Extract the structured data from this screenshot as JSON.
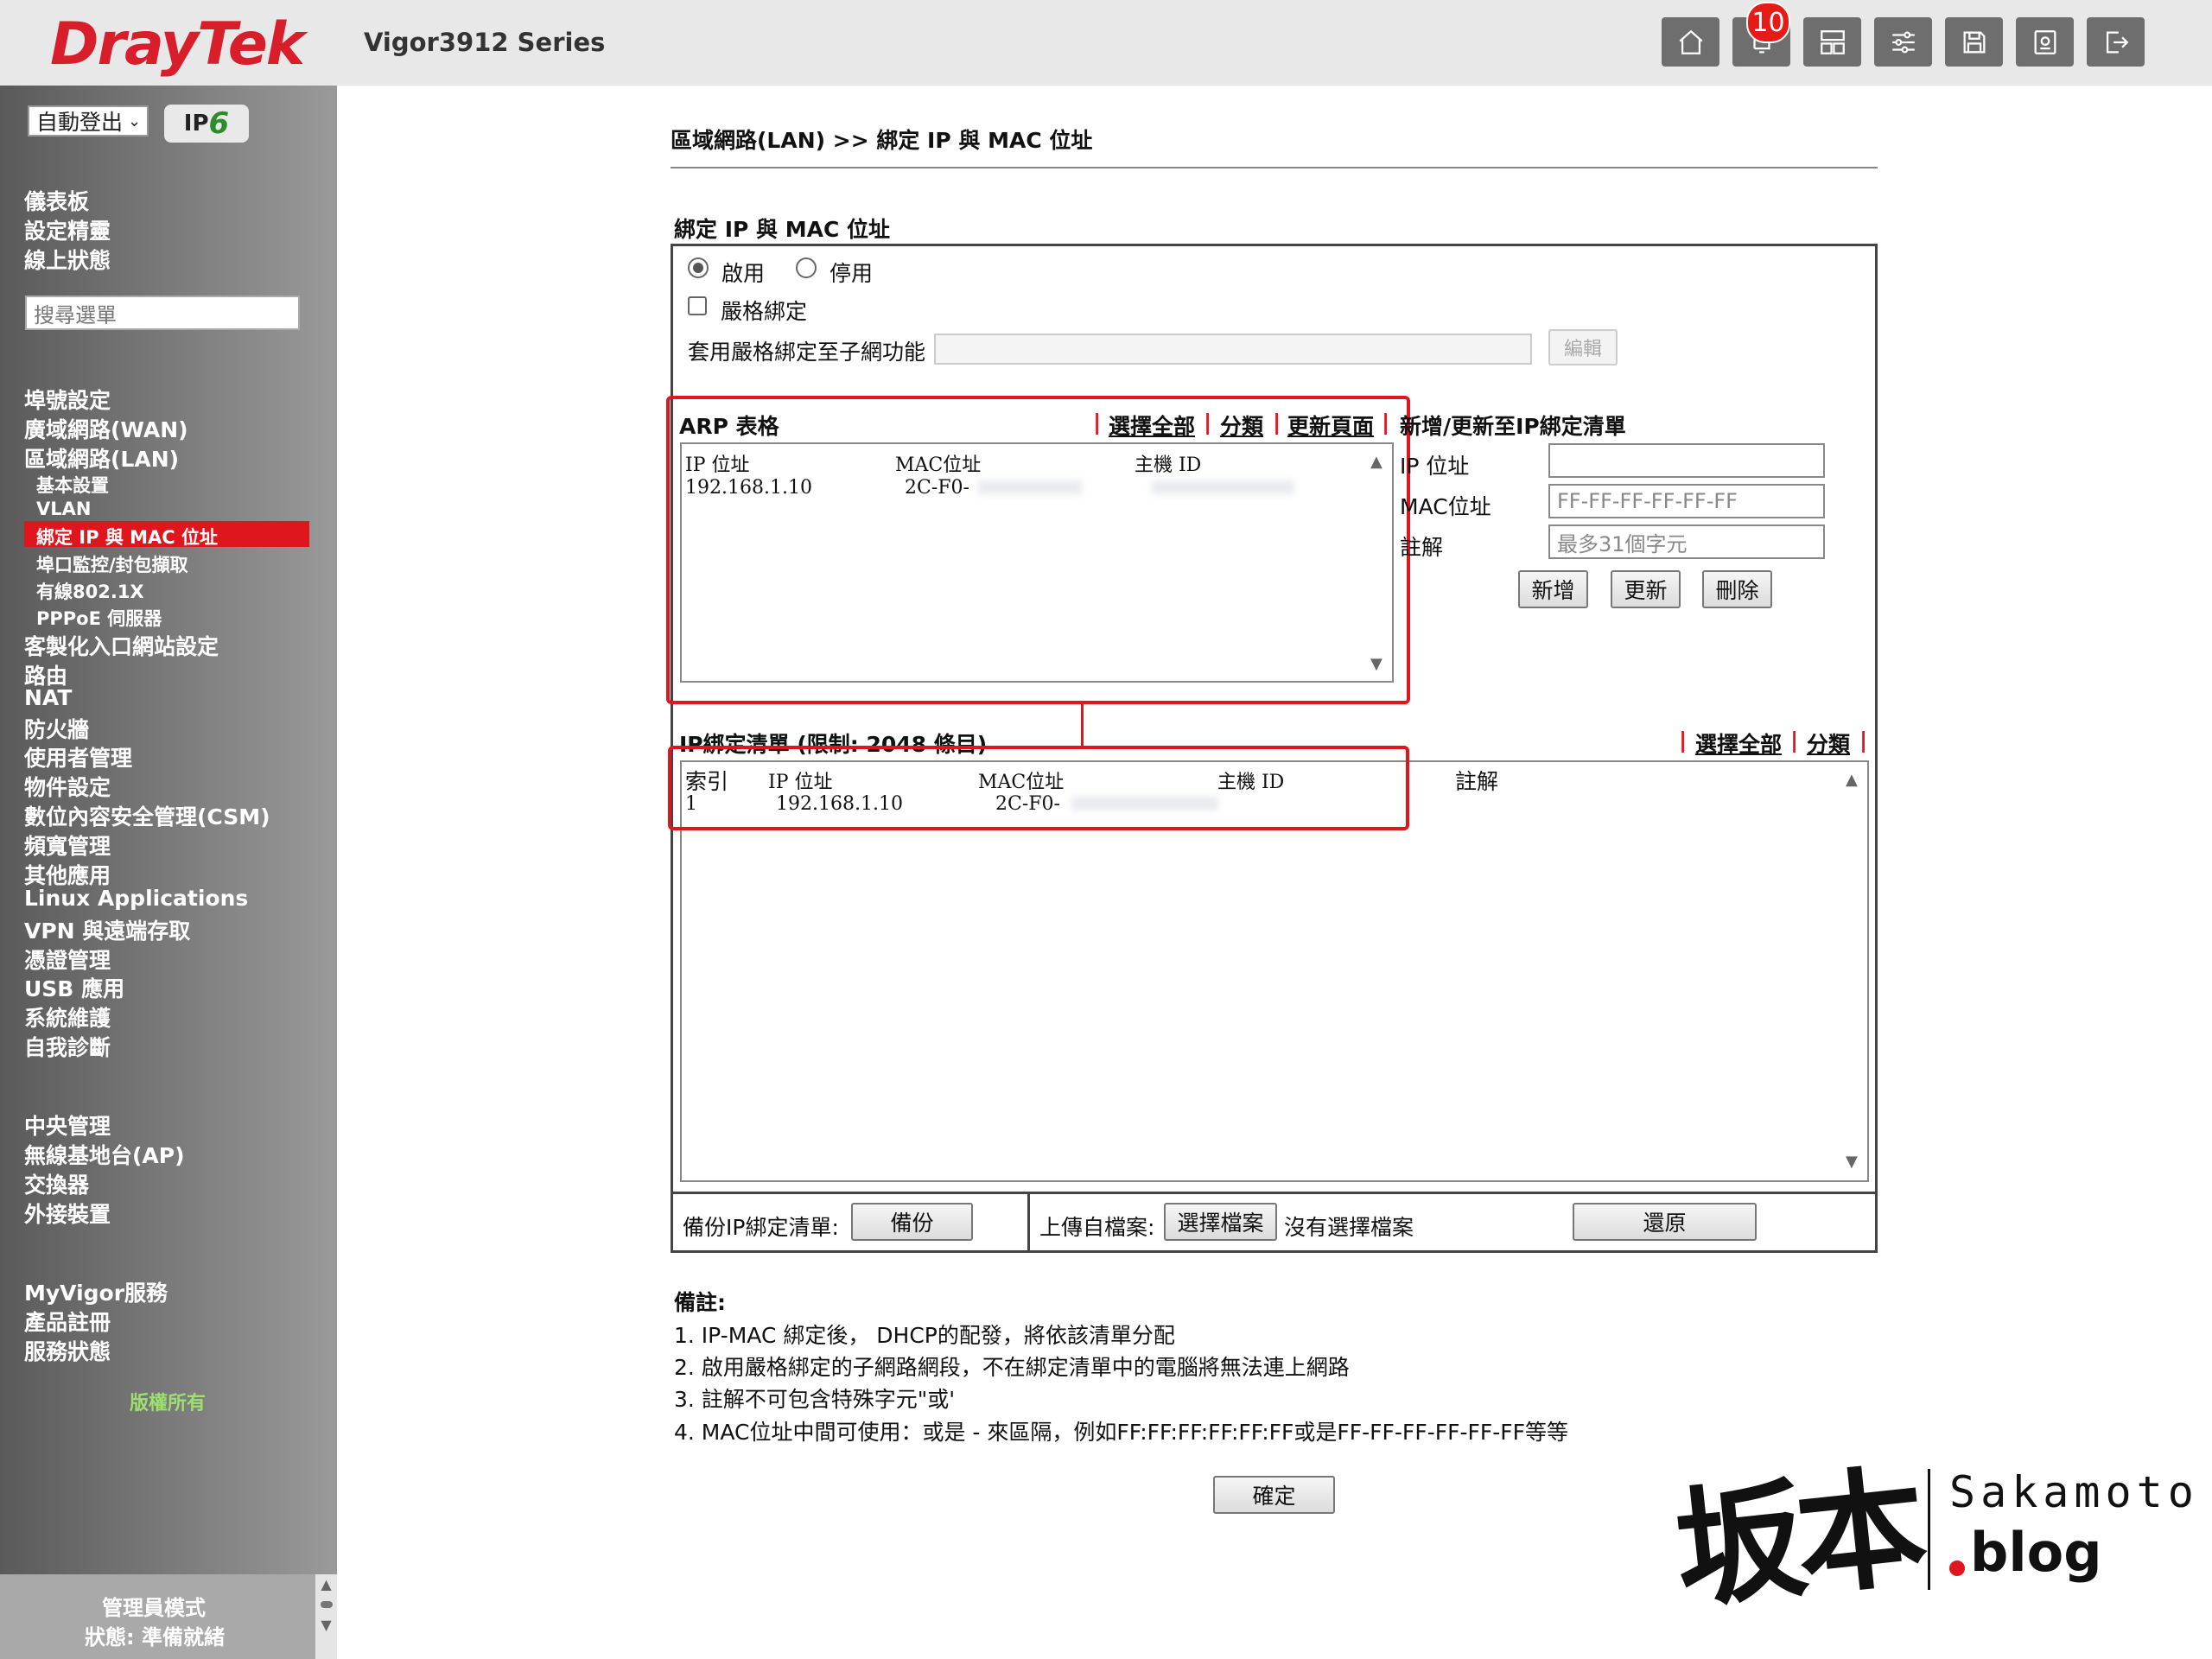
{
  "header": {
    "logo": "DrayTek",
    "model": "Vigor3912 Series",
    "notification_count": "10",
    "buttons": [
      "home-icon",
      "bell-icon",
      "layout-icon",
      "sliders-icon",
      "save-icon",
      "config-icon",
      "logout-icon"
    ]
  },
  "sidebar": {
    "logout_select": "自動登出",
    "ipv6_badge": "IPv6",
    "ipv6_v": "6",
    "top_items": [
      "儀表板",
      "設定精靈",
      "線上狀態"
    ],
    "search_placeholder": "搜尋選單",
    "items": [
      "埠號設定",
      "廣域網路(WAN)",
      "區域網路(LAN)"
    ],
    "lan_sub": [
      "基本設置",
      "VLAN",
      "綁定 IP 與 MAC 位址",
      "埠口監控/封包擷取",
      "有線802.1X",
      "PPPoE 伺服器"
    ],
    "items2": [
      "客製化入口網站設定",
      "路由",
      "NAT",
      "防火牆",
      "使用者管理",
      "物件設定",
      "數位內容安全管理(CSM)",
      "頻寬管理",
      "其他應用",
      "Linux Applications",
      "VPN 與遠端存取",
      "憑證管理",
      "USB 應用",
      "系統維護",
      "自我診斷"
    ],
    "central": [
      "中央管理",
      "無線基地台(AP)",
      "交換器",
      "外接裝置"
    ],
    "myvigor": [
      "MyVigor服務",
      "產品註冊",
      "服務狀態"
    ],
    "copyright": "版權所有",
    "mode": "管理員模式",
    "status": "狀態: 準備就緒"
  },
  "main": {
    "breadcrumb": "區域網路(LAN) >> 綁定 IP 與 MAC 位址",
    "section_title": "綁定 IP 與 MAC 位址",
    "enable_label": "啟用",
    "disable_label": "停用",
    "strict_label": "嚴格綁定",
    "apply_strict_label": "套用嚴格綁定至子網功能",
    "edit_button": "編輯",
    "arp": {
      "title": "ARP 表格",
      "select_all": "選擇全部",
      "sort": "分類",
      "refresh": "更新頁面",
      "columns": [
        "IP 位址",
        "MAC位址",
        "主機 ID"
      ],
      "rows": [
        {
          "ip": "192.168.1.10",
          "mac": "2C-F0-"
        }
      ]
    },
    "add_update": {
      "title": "新增/更新至IP綁定清單",
      "ip_label": "IP 位址",
      "mac_label": "MAC位址",
      "mac_placeholder": "FF-FF-FF-FF-FF-FF",
      "comment_label": "註解",
      "comment_placeholder": "最多31個字元",
      "add": "新增",
      "update": "更新",
      "delete": "刪除"
    },
    "binding": {
      "title": "IP綁定清單 (限制: 2048 條目)",
      "select_all": "選擇全部",
      "sort": "分類",
      "columns": [
        "索引",
        "IP 位址",
        "MAC位址",
        "主機 ID",
        "註解"
      ],
      "rows": [
        {
          "index": "1",
          "ip": "192.168.1.10",
          "mac": "2C-F0-"
        }
      ]
    },
    "backup_label": "備份IP綁定清單:",
    "backup_button": "備份",
    "upload_label": "上傳自檔案:",
    "choose_file": "選擇檔案",
    "no_file": "沒有選擇檔案",
    "restore": "還原",
    "notes_title": "備註:",
    "notes": [
      "1. IP-MAC 綁定後， DHCP的配發，將依該清單分配",
      "2. 啟用嚴格綁定的子網路網段，不在綁定清單中的電腦將無法連上網路",
      "3. 註解不可包含特殊字元\"或'",
      "4. MAC位址中間可使用：或是 - 來區隔，例如FF:FF:FF:FF:FF:FF或是FF-FF-FF-FF-FF-FF等等"
    ],
    "ok": "確定"
  },
  "watermark": {
    "kanji": "坂本",
    "name": "Sakamoto",
    "blog": "blog"
  },
  "colors": {
    "brand_red": "#d81e2a",
    "active_nav": "#e0161e",
    "header_btn": "#6e6e6e"
  }
}
